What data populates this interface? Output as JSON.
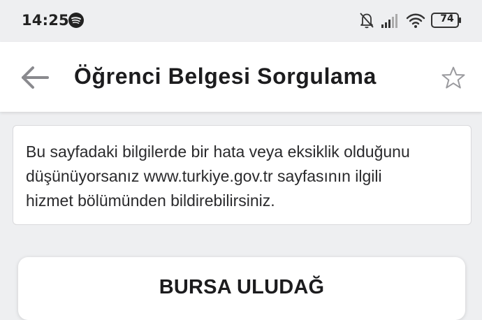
{
  "status_bar": {
    "time": "14:25",
    "battery_level": "74",
    "icons": [
      "spotify-icon",
      "mute-bell-icon",
      "signal-icon",
      "wifi-icon",
      "battery-icon"
    ]
  },
  "app_bar": {
    "title": "Öğrenci Belgesi Sorgulama",
    "back_icon": "arrow-left-icon",
    "favorite_icon": "star-outline-icon"
  },
  "notice": {
    "lines": [
      "Bu sayfadaki bilgilerde bir hata veya eksiklik olduğunu",
      "düşünüyorsanız www.turkiye.gov.tr sayfasının ilgili",
      "hizmet bölümünden bildirebilirsiniz."
    ]
  },
  "result": {
    "university": "BURSA ULUDAĞ"
  },
  "colors": {
    "background": "#eeeff1",
    "surface": "#ffffff",
    "icon_gray": "#8a8a8e",
    "text": "#1c1c1e"
  }
}
